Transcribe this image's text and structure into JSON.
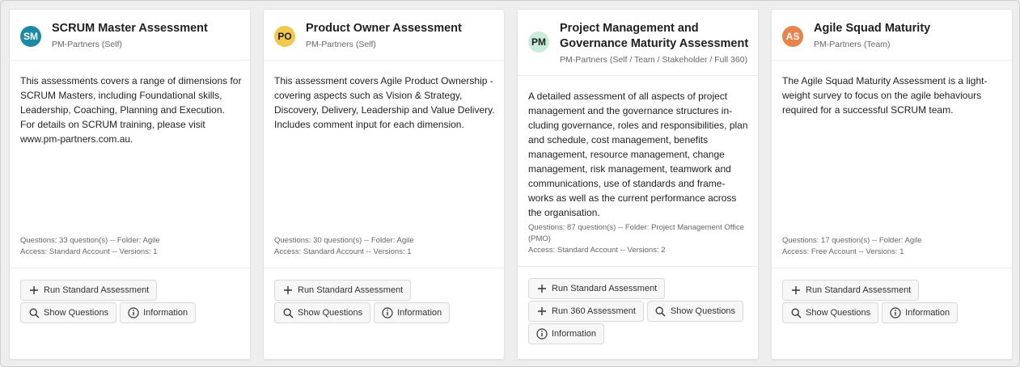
{
  "cards": [
    {
      "avatar": "SM",
      "avatar_bg": "#1b8aa5",
      "avatar_fg": "#ffffff",
      "title": "SCRUM Master Assessment",
      "subtitle": "PM-Partners (Self)",
      "description": "This assessments covers a range of dimensions for SCRUM Masters, including Foundational skills, Leadership, Coaching, Planning and Execution. For details on SCRUM training, please visit www.pm-partners.com.au.",
      "meta_line1": "Questions: 33 question(s) -- Folder: Agile",
      "meta_line2": "Access: Standard Account -- Versions: 1",
      "run_standard": "Run Standard Assessment",
      "show_questions": "Show Questions",
      "information": "Information"
    },
    {
      "avatar": "PO",
      "avatar_bg": "#f2c94c",
      "avatar_fg": "#1f1f1f",
      "title": "Product Owner Assessment",
      "subtitle": "PM-Partners (Self)",
      "description": "This assessment covers Agile Product Ownership - covering aspects such as Vision & Strategy, Discovery, Delivery, Leadership and Value Delivery. Includes comment input for each dimension.",
      "meta_line1": "Questions: 30 question(s) -- Folder: Agile",
      "meta_line2": "Access: Standard Account -- Versions: 1",
      "run_standard": "Run Standard Assessment",
      "show_questions": "Show Questions",
      "information": "Information"
    },
    {
      "avatar": "PM",
      "avatar_bg": "#c9ecdc",
      "avatar_fg": "#1f1f1f",
      "title": "Project Management and Governance Maturity Assessment",
      "subtitle": "PM-Partners (Self / Team / Stakeholder / Full 360)",
      "description": "A detailed assessment of all aspects of project management and the governance structures in-cluding governance, roles and responsibilities, plan and schedule, cost management, benefits management, resource management, change management, risk management, teamwork and communications, use of standards and frame-works as well as the current performance across the organisation.",
      "meta_line1": "Questions: 87 question(s) -- Folder: Project Management Office (PMO)",
      "meta_line2": "Access: Standard Account -- Versions: 2",
      "run_standard": "Run Standard Assessment",
      "run_360": "Run 360 Assessment",
      "show_questions": "Show Questions",
      "information": "Information"
    },
    {
      "avatar": "AS",
      "avatar_bg": "#e8834a",
      "avatar_fg": "#ffffff",
      "title": "Agile Squad Maturity",
      "subtitle": "PM-Partners (Team)",
      "description": "The Agile Squad Maturity Assessment is a light-weight survey to focus on the agile behaviours required for a successful SCRUM team.",
      "meta_line1": "Questions: 17 question(s) -- Folder: Agile",
      "meta_line2": "Access: Free Account -- Versions: 1",
      "run_standard": "Run Standard Assessment",
      "show_questions": "Show Questions",
      "information": "Information"
    }
  ],
  "icons": {
    "run": "plus-icon",
    "show": "search-icon",
    "info": "info-icon"
  }
}
